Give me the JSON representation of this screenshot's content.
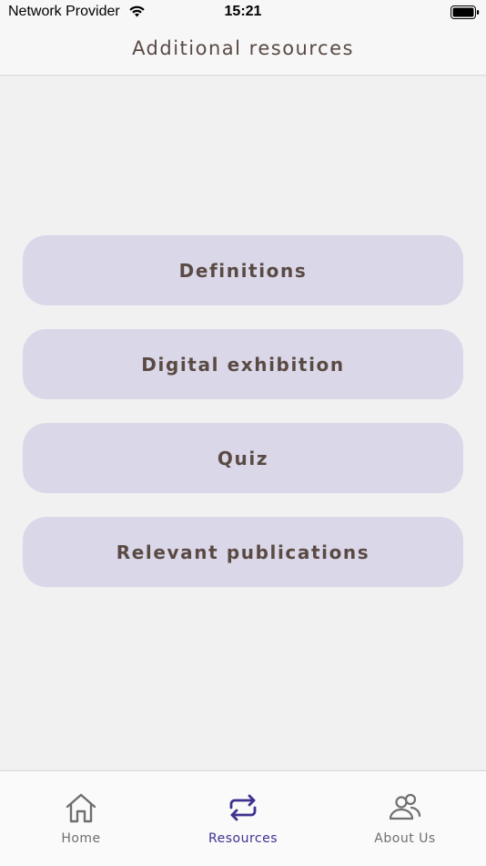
{
  "status_bar": {
    "carrier": "Network Provider",
    "time": "15:21",
    "wifi_icon": "wifi-icon",
    "battery_icon": "battery-icon"
  },
  "nav": {
    "title": "Additional resources"
  },
  "resources": {
    "buttons": [
      {
        "label": "Definitions"
      },
      {
        "label": "Digital exhibition"
      },
      {
        "label": "Quiz"
      },
      {
        "label": "Relevant publications"
      }
    ]
  },
  "tab_bar": {
    "tabs": [
      {
        "label": "Home",
        "icon": "home-icon",
        "active": false
      },
      {
        "label": "Resources",
        "icon": "repeat-arrows-icon",
        "active": true
      },
      {
        "label": "About Us",
        "icon": "people-icon",
        "active": false
      }
    ]
  },
  "colors": {
    "background": "#f1f1f1",
    "button_fill": "#dad7e8",
    "text": "#5a4a44",
    "active_tab": "#3d3290",
    "inactive_tab": "#6f6f6f"
  }
}
